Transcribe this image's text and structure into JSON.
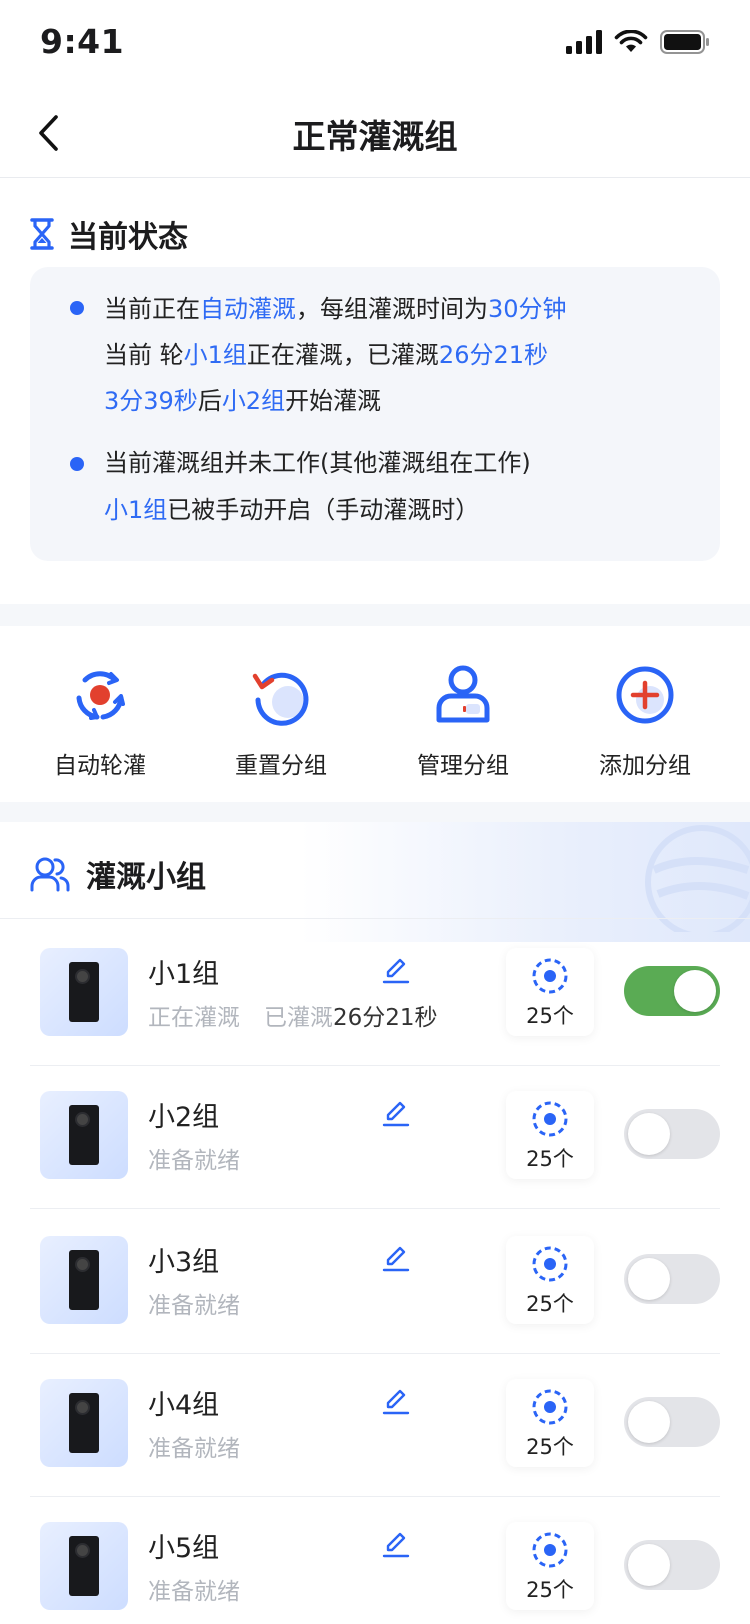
{
  "status_bar": {
    "time": "9:41"
  },
  "nav": {
    "title": "正常灌溉组"
  },
  "current_status": {
    "heading": "当前状态",
    "lines": [
      {
        "parts": [
          {
            "t": "当前正在"
          },
          {
            "t": "自动灌溉",
            "hl": true
          },
          {
            "t": "，每组灌溉时间为"
          },
          {
            "t": "30分钟",
            "hl": true
          }
        ]
      },
      {
        "parts": [
          {
            "t": "当前 轮"
          },
          {
            "t": "小1组",
            "hl": true
          },
          {
            "t": "正在灌溉，已灌溉"
          },
          {
            "t": "26分21秒",
            "hl": true
          }
        ]
      },
      {
        "parts": [
          {
            "t": "3分39秒",
            "hl": true
          },
          {
            "t": "后"
          },
          {
            "t": "小2组",
            "hl": true
          },
          {
            "t": "开始灌溉"
          }
        ]
      },
      {
        "parts": [
          {
            "t": "当前灌溉组并未工作(其他灌溉组在工作)"
          }
        ]
      },
      {
        "parts": [
          {
            "t": "小1组",
            "hl": true
          },
          {
            "t": "已被手动开启（手动灌溉时）"
          }
        ]
      }
    ]
  },
  "actions": [
    {
      "label": "自动轮灌",
      "icon": "auto-rotate-icon"
    },
    {
      "label": "重置分组",
      "icon": "reset-icon"
    },
    {
      "label": "管理分组",
      "icon": "manage-user-icon"
    },
    {
      "label": "添加分组",
      "icon": "add-circle-icon"
    }
  ],
  "groups": {
    "heading": "灌溉小组",
    "items": [
      {
        "name": "小1组",
        "status": "正在灌溉",
        "elapsed_label": "已灌溉",
        "elapsed": "26分21秒",
        "count": "25个",
        "on": true
      },
      {
        "name": "小2组",
        "status": "准备就绪",
        "count": "25个",
        "on": false
      },
      {
        "name": "小3组",
        "status": "准备就绪",
        "count": "25个",
        "on": false
      },
      {
        "name": "小4组",
        "status": "准备就绪",
        "count": "25个",
        "on": false
      },
      {
        "name": "小5组",
        "status": "准备就绪",
        "count": "25个",
        "on": false
      }
    ]
  },
  "colors": {
    "accent": "#2f6bf4",
    "toggle_on": "#5aab54",
    "icon_red": "#e2402e"
  }
}
